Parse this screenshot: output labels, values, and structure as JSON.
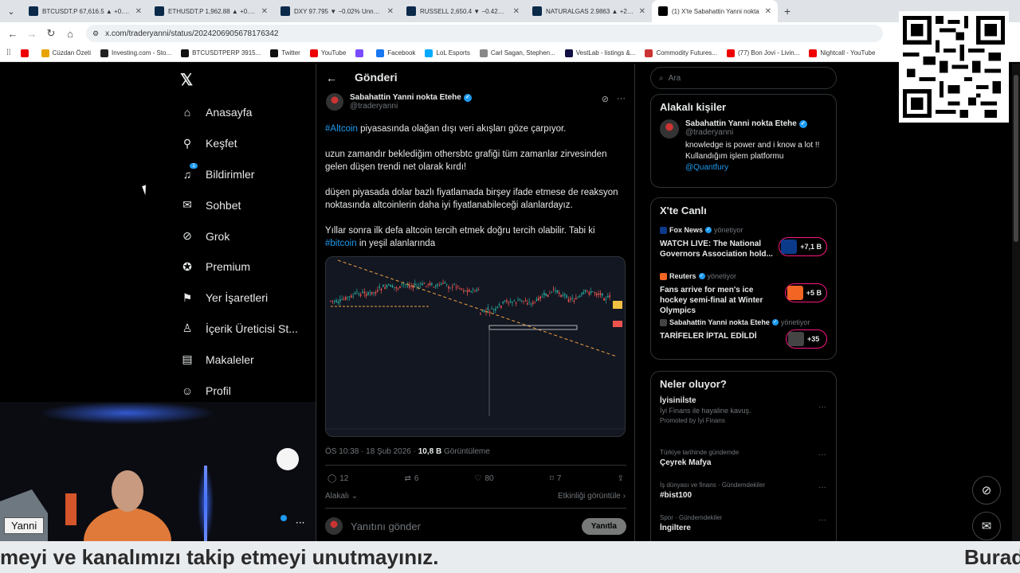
{
  "browser": {
    "tabs": [
      {
        "title": "BTCUSDT.P 67,616.5 ▲ +0.96%",
        "color": "#0b2a4a"
      },
      {
        "title": "ETHUSDT.P 1,962.88 ▲ +0.76%",
        "color": "#0b2a4a"
      },
      {
        "title": "DXY 97.795 ▼ −0.02% Unnamed",
        "color": "#0b2a4a"
      },
      {
        "title": "RUSSELL 2,650.4 ▼ −0.42% Un",
        "color": "#0b2a4a"
      },
      {
        "title": "NATURALGAS 2.9863 ▲ +2.19%",
        "color": "#0b2a4a"
      },
      {
        "title": "(1) X'te Sabahattin Yanni nokta",
        "color": "#000000"
      }
    ],
    "url": "x.com/traderyanni/status/2024206905678176342",
    "bookmarks": [
      "",
      "Cüzdan Özeti",
      "Investing.com - Sto...",
      "BTCUSDTPERP 3915...",
      "Twitter",
      "YouTube",
      "",
      "Facebook",
      "LoL Esports",
      "Carl Sagan, Stephen...",
      "VestLab - listings &...",
      "Commodity Futures...",
      "(77) Bon Jovi - Livin...",
      "Nightcall - YouTube"
    ]
  },
  "nav": {
    "items": [
      {
        "label": "Anasayfa",
        "icon": "home-icon"
      },
      {
        "label": "Keşfet",
        "icon": "search-icon"
      },
      {
        "label": "Bildirimler",
        "icon": "bell-icon",
        "badge": "1"
      },
      {
        "label": "Sohbet",
        "icon": "mail-icon"
      },
      {
        "label": "Grok",
        "icon": "grok-icon"
      },
      {
        "label": "Premium",
        "icon": "verified-icon"
      },
      {
        "label": "Yer İşaretleri",
        "icon": "bookmark-icon"
      },
      {
        "label": "İçerik Üreticisi St...",
        "icon": "creator-icon"
      },
      {
        "label": "Makaleler",
        "icon": "article-icon"
      },
      {
        "label": "Profil",
        "icon": "profile-icon"
      }
    ]
  },
  "post": {
    "header": "Gönderi",
    "author_name": "Sabahattin Yanni nokta Etehe",
    "author_handle": "@traderyanni",
    "p1_tag": "#Altcoin",
    "p1_rest": " piyasasında olağan dışı veri akışları göze çarpıyor.",
    "p2": "uzun zamandır beklediğim othersbtc grafiği tüm zamanlar zirvesinden gelen düşen trendi  net olarak kırdı!",
    "p3": "düşen piyasada dolar bazlı fiyatlamada birşey ifade etmese de reaksyon noktasında altcoinlerin daha iyi fiyatlanabileceği alanlardayız.",
    "p4": "Yıllar sonra ilk defa altcoin tercih etmek doğru tercih olabilir. Tabi ki",
    "p4_tag": "#bitcoin",
    "p4_rest": " in yeşil alanlarında",
    "time": "ÖS 10:38 · 18 Şub 2026 · ",
    "views": "10,8 B",
    "views_label": " Görüntüleme",
    "replies": "12",
    "reposts": "6",
    "likes": "80",
    "bookmarks": "7",
    "related": "Alakalı",
    "activity": "Etkinliği görüntüle",
    "reply_placeholder": "Yanıtını gönder",
    "reply_button": "Yanıtla"
  },
  "right": {
    "search_placeholder": "Ara",
    "related_title": "Alakalı kişiler",
    "related_name": "Sabahattin Yanni nokta Etehe",
    "related_handle": "@traderyanni",
    "related_bio": "knowledge is power and i know a lot !! Kullandığım işlem platformu",
    "related_link": "@Quantfury",
    "live_title": "X'te Canlı",
    "live": [
      {
        "host": "Fox News",
        "role": "yönetiyor",
        "title": "WATCH LIVE: The National Governors Association hold...",
        "count": "+7,1 B",
        "color": "#0b3a8a"
      },
      {
        "host": "Reuters",
        "role": "yönetiyor",
        "title": "Fans arrive for men's ice hockey semi-final at Winter Olympics",
        "count": "+5 B",
        "color": "#f26522"
      },
      {
        "host": "Sabahattin Yanni nokta Etehe",
        "role": "yönetiyor",
        "title": "TARİFELER İPTAL EDİLDİ",
        "count": "+35",
        "color": "#444444"
      }
    ],
    "trends_title": "Neler oluyor?",
    "trends": [
      {
        "cat": "",
        "name": "İyisiniİste",
        "sub": "İyi Finans ile hayaline kavuş.",
        "promo": "Promoted by İyi Finans"
      },
      {
        "cat": "Türkiye tarihinde gündemde",
        "name": "Çeyrek Mafya"
      },
      {
        "cat": "İş dünyası ve finans · Gündemdekiler",
        "name": "#bist100"
      },
      {
        "cat": "Spor · Gündemdekiler",
        "name": "İngiltere"
      }
    ]
  },
  "webcam": {
    "name": "Yanni"
  },
  "ticker": {
    "left": "meyi ve kanalımızı takip etmeyi unutmayınız.",
    "right": "Burad"
  }
}
